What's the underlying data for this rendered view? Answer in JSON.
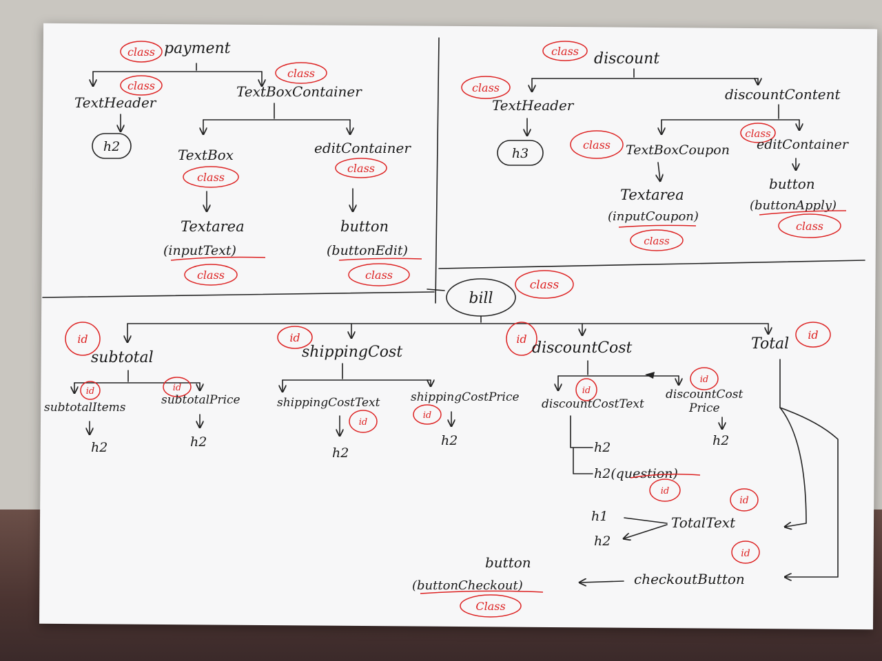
{
  "payment": {
    "root": "payment",
    "root_tag": "class",
    "textHeader": "TextHeader",
    "textHeader_tag": "class",
    "h2": "h2",
    "container": "TextBoxContainer",
    "container_tag": "class",
    "textBox": "TextBox",
    "textBox_tag": "class",
    "textarea": "Textarea",
    "textarea_id": "(inputText)",
    "textarea_tag": "class",
    "editContainer": "editContainer",
    "editContainer_tag": "class",
    "button": "button",
    "button_id": "(buttonEdit)",
    "button_tag": "class"
  },
  "discount": {
    "root": "discount",
    "root_tag": "class",
    "textHeader": "TextHeader",
    "textHeader_tag": "class",
    "h3": "h3",
    "content": "discountContent",
    "textBoxCoupon": "TextBoxCoupon",
    "textBoxCoupon_tag": "class",
    "editContainer": "editContainer",
    "editContainer_tag": "class",
    "textarea": "Textarea",
    "textarea_id": "(inputCoupon)",
    "textarea_tag": "class",
    "button": "button",
    "button_id": "(buttonApply)",
    "button_tag": "class"
  },
  "bill": {
    "root": "bill",
    "root_tag": "class",
    "subtotal": "subtotal",
    "subtotal_tag": "id",
    "subtotalItems": "subtotalItems",
    "subtotalItems_tag": "id",
    "subtotalPrice": "subtotalPrice",
    "subtotalPrice_tag": "id",
    "shippingCost": "shippingCost",
    "shippingCost_tag": "id",
    "shippingCostText": "shippingCostText",
    "shippingCostText_tag": "id",
    "shippingCostPrice": "shippingCostPrice",
    "shippingCostPrice_tag": "id",
    "discountCost": "discountCost",
    "discountCost_tag": "id",
    "discountCostText": "discountCostText",
    "discountCostText_tag": "id",
    "discountCostPrice": "discountCost",
    "discountCostPrice2": "Price",
    "discountCostPrice_tag": "id",
    "h2": "h2",
    "h2Question": "h2(question)",
    "question_tag": "id",
    "total": "Total",
    "total_tag": "id",
    "totalText": "TotalText",
    "totalText_tag": "id",
    "h1": "h1",
    "checkoutButton": "checkoutButton",
    "checkoutButton_tag": "id",
    "button": "button",
    "button_id": "(buttonCheckout)",
    "button_tag": "Class"
  },
  "colors": {
    "ink": "#222222",
    "annotation": "#dd2222",
    "paper": "#f7f7f8"
  }
}
